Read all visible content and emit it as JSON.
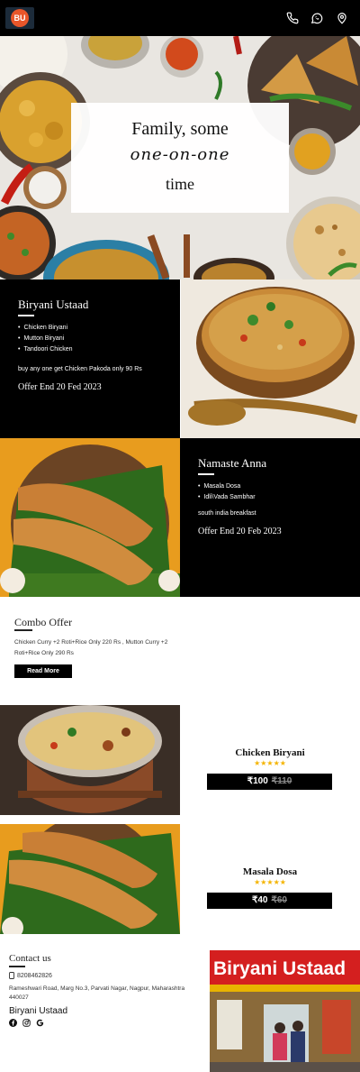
{
  "header": {
    "logo_text": "BU",
    "icons": [
      "phone-icon",
      "whatsapp-icon",
      "location-pin-icon"
    ]
  },
  "hero": {
    "line1": "Family, some",
    "line2": "one-on-one",
    "line3": "time"
  },
  "offers": [
    {
      "title": "Biryani Ustaad",
      "items": [
        "Chicken Biryani",
        "Mutton Biryani",
        "Tandoori Chicken"
      ],
      "description": "buy any one get Chicken Pakoda only 90 Rs",
      "end": "Offer End 20 Fed 2023"
    },
    {
      "title": "Namaste Anna",
      "items": [
        "Masala Dosa",
        "Idli\\Vada Sambhar"
      ],
      "description": "south india breakfast",
      "end": "Offer End 20 Feb 2023"
    }
  ],
  "combo": {
    "title": "Combo Offer",
    "description": "Chicken Curry +2 Roti+Rice Only 220 Rs , Mutton Curry +2 Roti+Rice Only 290 Rs",
    "button": "Read More"
  },
  "products": [
    {
      "name": "Chicken Biryani",
      "stars": "★★★★★",
      "rating": 4.5,
      "price": "₹100",
      "old_price": "₹110"
    },
    {
      "name": "Masala Dosa",
      "stars": "★★★★★",
      "rating": 4.5,
      "price": "₹40",
      "old_price": "₹60"
    }
  ],
  "contact": {
    "title": "Contact us",
    "phone": "8208462826",
    "address": "Rameshwari Road, Marg No.3, Parvati Nagar, Nagpur, Maharashtra 440027",
    "brand": "Biryani Ustaad",
    "social_icons": [
      "facebook-icon",
      "instagram-icon",
      "google-icon"
    ],
    "storefront_sign": "Biryani Ustaad"
  },
  "colors": {
    "header_bg": "#000000",
    "accent": "#e8562a",
    "star": "#f4b400"
  }
}
